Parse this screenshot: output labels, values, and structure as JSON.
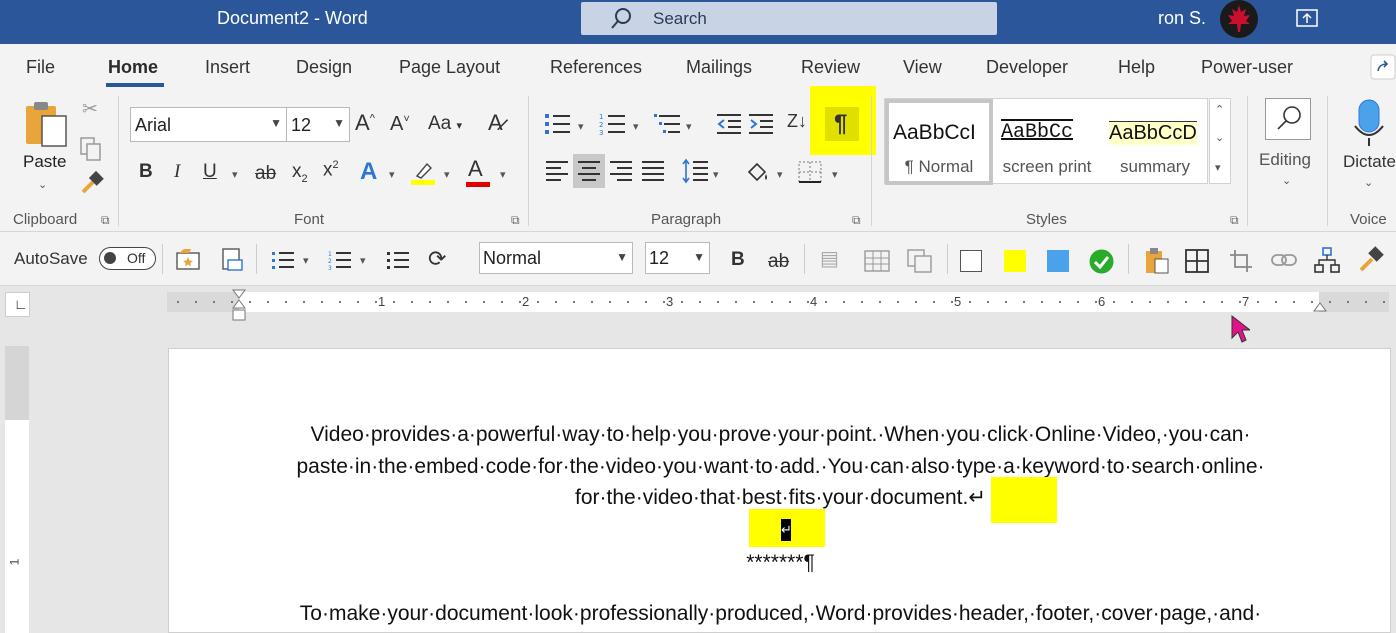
{
  "titlebar": {
    "title": "Document2  -  Word",
    "search_placeholder": "Search",
    "user": "ron S."
  },
  "menu": {
    "tabs": [
      "File",
      "Home",
      "Insert",
      "Design",
      "Page Layout",
      "References",
      "Mailings",
      "Review",
      "View",
      "Developer",
      "Help",
      "Power-user"
    ],
    "active": "Home"
  },
  "ribbon": {
    "clipboard": {
      "paste_label": "Paste",
      "group_label": "Clipboard"
    },
    "font": {
      "font_name": "Arial",
      "font_size": "12",
      "group_label": "Font",
      "case_label": "Aa",
      "grow": "A",
      "shrink": "A"
    },
    "paragraph": {
      "group_label": "Paragraph",
      "pilcrow": "¶"
    },
    "styles": {
      "group_label": "Styles",
      "items": [
        {
          "sample": "AaBbCcI",
          "name": "¶ Normal"
        },
        {
          "sample": "AaBbCc",
          "name": "screen print"
        },
        {
          "sample": "AaBbCcD",
          "name": "summary"
        }
      ]
    },
    "editing": {
      "label": "Editing"
    },
    "voice": {
      "label": "Dictate",
      "group_label": "Voice"
    }
  },
  "qat": {
    "autosave_label": "AutoSave",
    "toggle_state": "Off",
    "style_value": "Normal",
    "size_value": "12",
    "bold": "B",
    "strike": "ab",
    "colors": {
      "yellow": "#ffff00",
      "blue": "#4aa3ea",
      "green": "#2bab2b"
    }
  },
  "ruler": {
    "numbers": [
      "1",
      "2",
      "3",
      "4",
      "5",
      "6",
      "7"
    ]
  },
  "document": {
    "para1_line1": "Video·provides·a·powerful·way·to·help·you·prove·your·point.·When·you·click·Online·Video,·you·can·",
    "para1_line2": "paste·in·the·embed·code·for·the·video·you·want·to·add.·You·can·also·type·a·keyword·to·search·online·",
    "para1_line3": "for·the·video·that·best·fits·your·document.",
    "break_mark": "↵",
    "stars": "*******¶",
    "para2_line1": "To·make·your·document·look·professionally·produced,·Word·provides·header,·footer,·cover·page,·and·"
  },
  "accent": {
    "word_blue": "#2b579a",
    "highlight": "#ffff00"
  }
}
